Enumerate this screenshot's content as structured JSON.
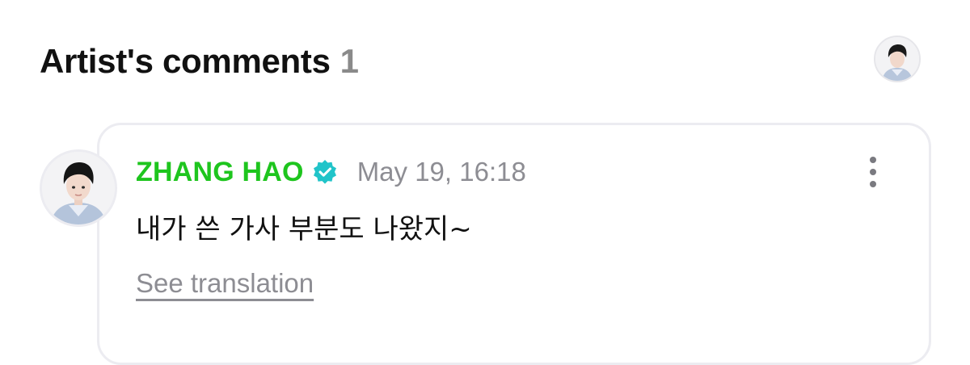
{
  "header": {
    "title": "Artist's comments",
    "count": "1"
  },
  "comment": {
    "author": "ZHANG HAO",
    "verified_icon": "verified-badge-icon",
    "timestamp": "May 19, 16:18",
    "text": "내가 쓴 가사 부분도 나왔지~",
    "translate_label": "See translation"
  },
  "colors": {
    "author": "#1ec51e",
    "verified": "#21c4c9",
    "muted": "#8d8d93",
    "card_border": "#ececf1"
  }
}
